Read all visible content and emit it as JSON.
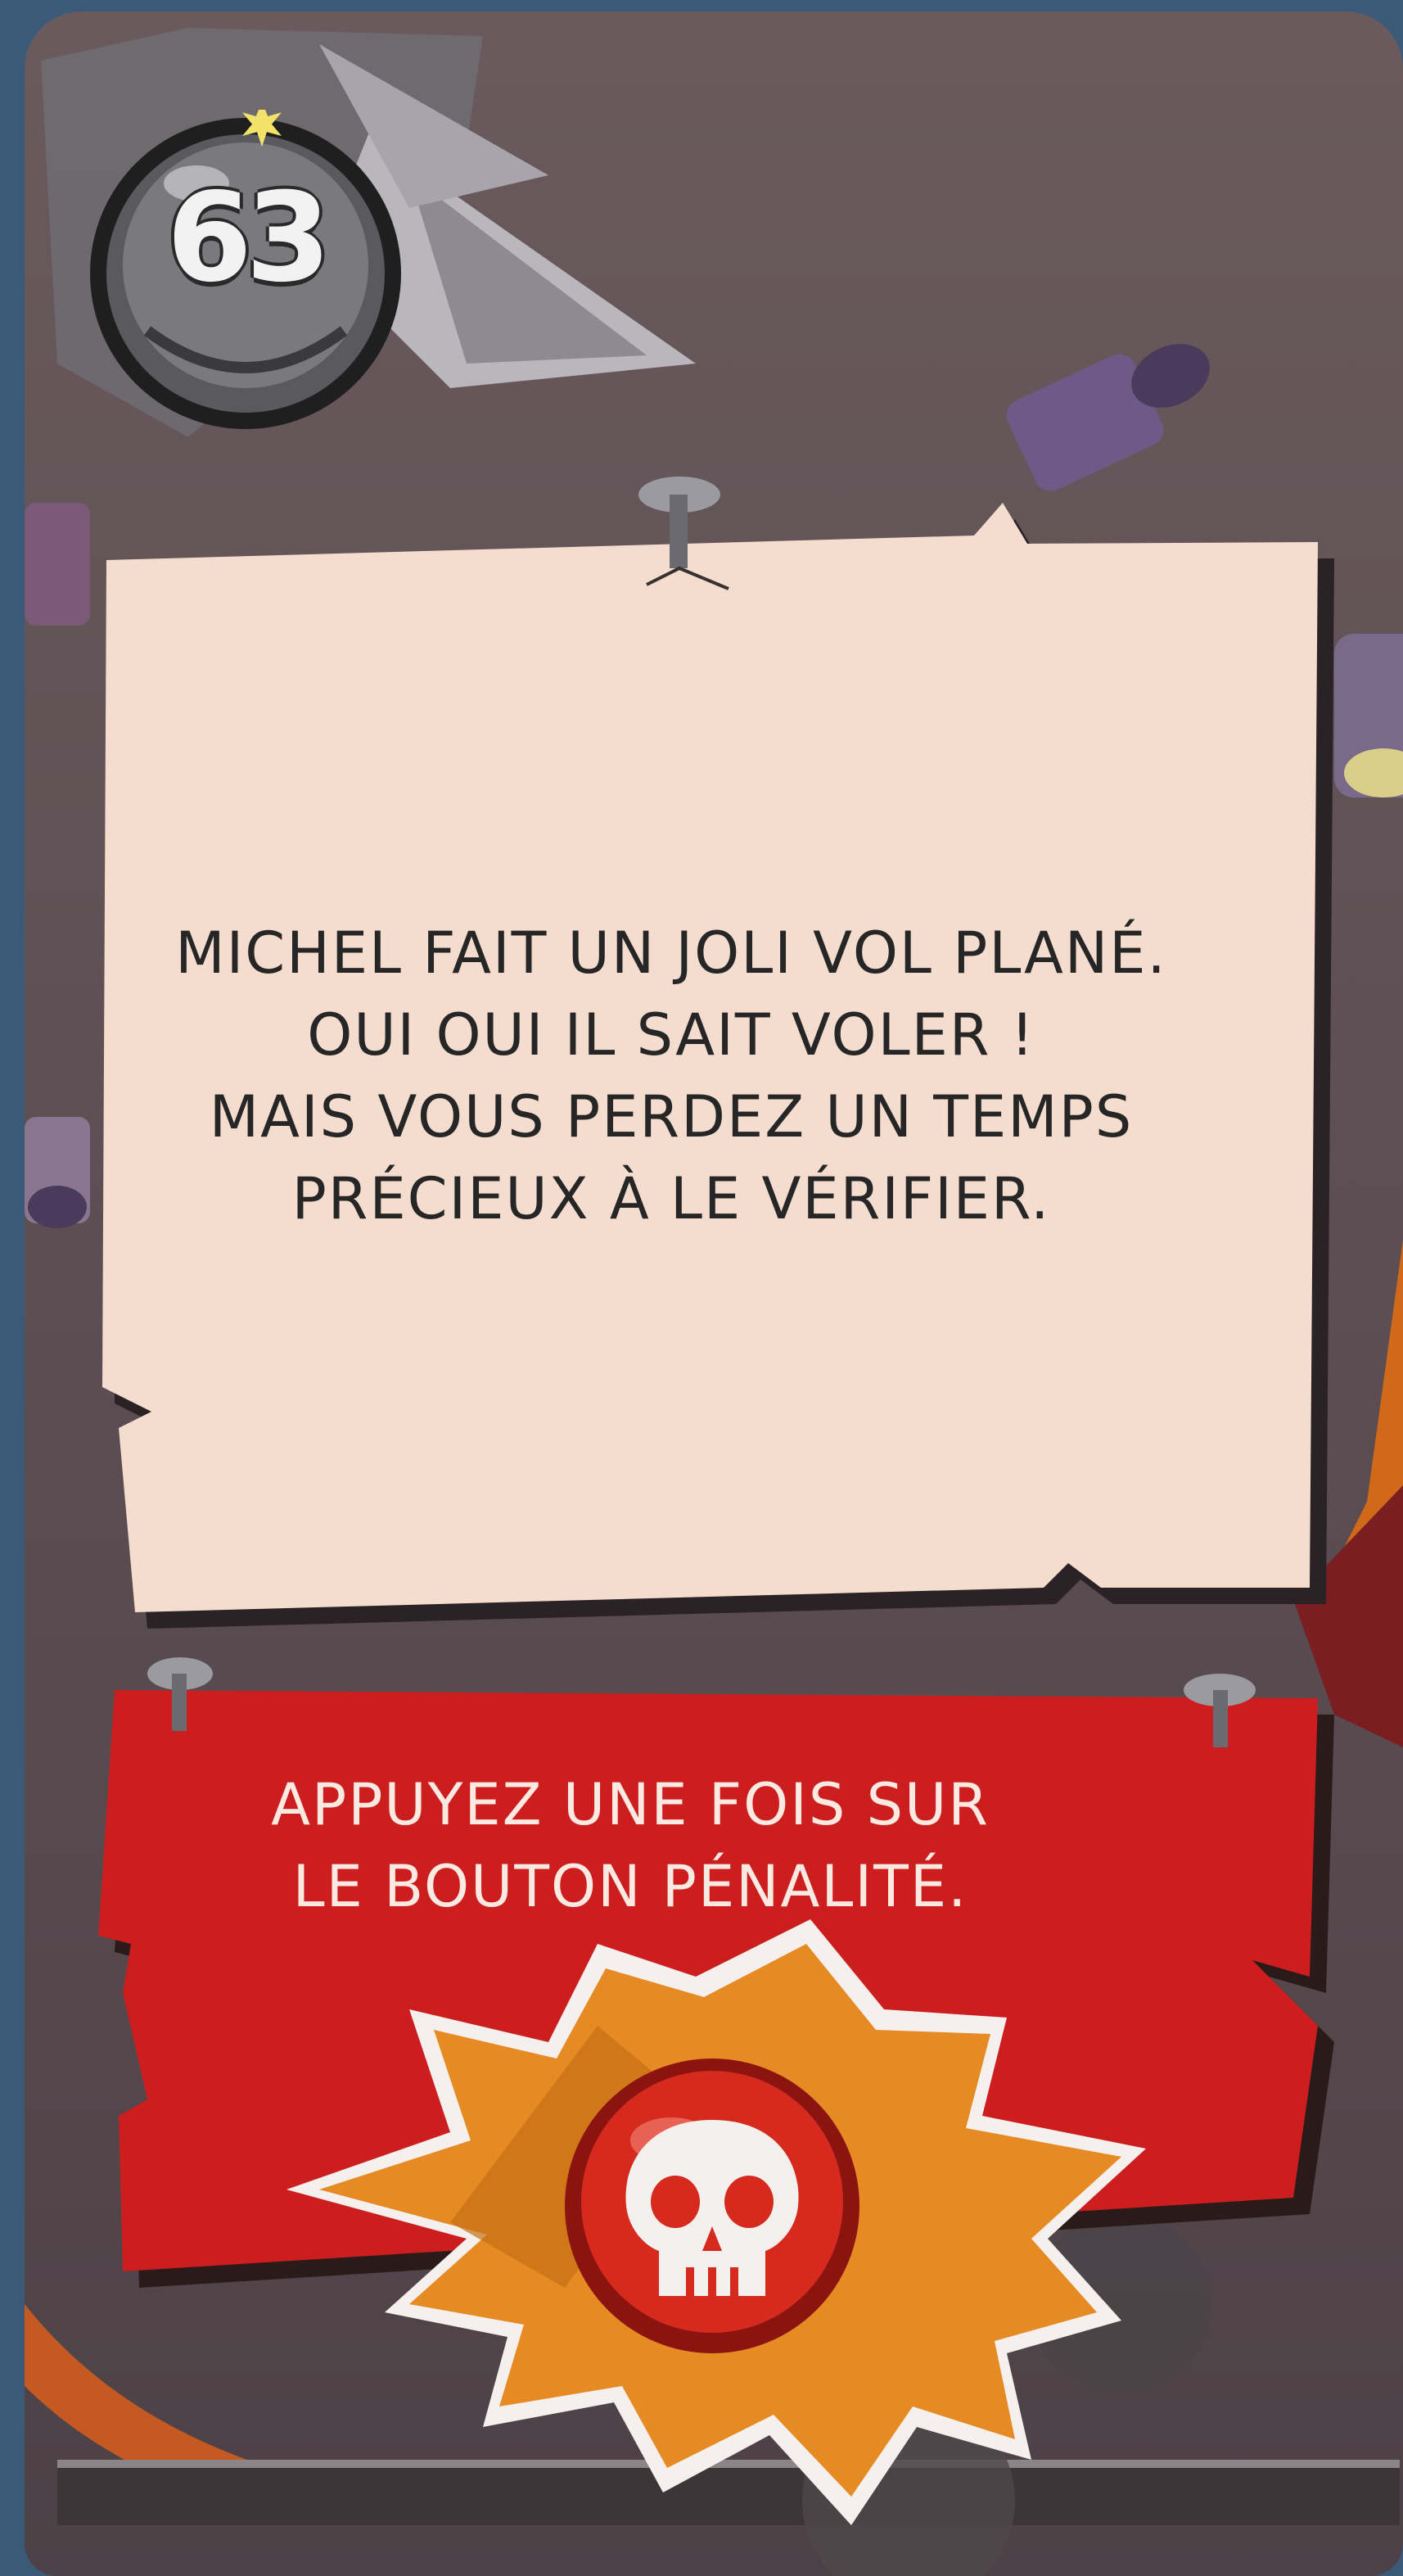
{
  "card": {
    "number": "63",
    "story_lines": [
      "Michel fait un joli vol plané.",
      "Oui oui il sait voler !",
      "Mais vous perdez un temps",
      "précieux à le vérifier."
    ],
    "action_lines": [
      "Appuyez une fois sur",
      "le bouton pénalité."
    ]
  },
  "icons": {
    "counter": "bomb-icon",
    "penalty": "skull-icon"
  },
  "colors": {
    "card_background": "#5e5054",
    "note_paper": "#f4dccf",
    "penalty_panel": "#cc1e1e",
    "starburst": "#e68a24",
    "skull_button": "#d62a1e"
  }
}
